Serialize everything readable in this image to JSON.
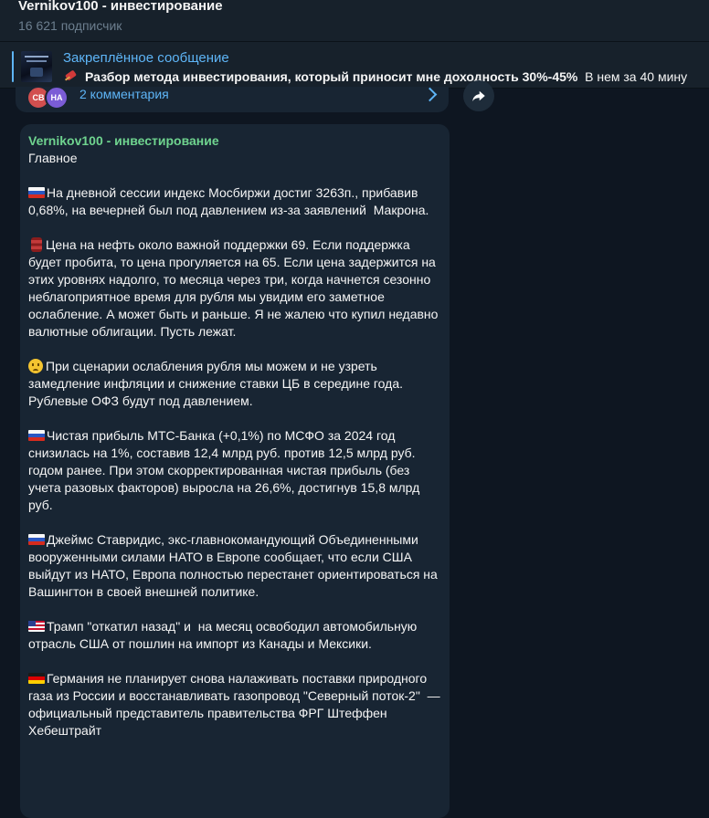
{
  "header": {
    "title": "Vernikov100 - инвестирование",
    "subscribers": "16 621 подписчик"
  },
  "pinned": {
    "label": "Закреплённое сообщение",
    "text_bold": "Разбор метода инвестирования, который приносит мне доходность 30%-45%",
    "text_rest": "В нем за 40 мину"
  },
  "prev_message": {
    "avatar1": "СВ",
    "avatar2": "НА",
    "comments": "2 комментария"
  },
  "message": {
    "sender": "Vernikov100 - инвестирование",
    "title": "Главное",
    "paragraphs": [
      "На дневной сессии индекс Мосбиржи достиг 3263п., прибавив 0,68%, на вечерней был под давлением из-за заявлений  Макрона.",
      "Цена на нефть около важной поддержки 69. Если поддержка будет пробита, то цена прогуляется на 65. Если цена задержится на этих уровнях надолго, то месяца через три, когда начнется сезонно неблагоприятное время для рубля мы увидим его заметное ослабление. А может быть и раньше. Я не жалею что купил недавно валютные облигации. Пусть лежат.",
      "При сценарии ослабления рубля мы можем и не узреть замедление инфляции и снижение ставки ЦБ в середине года. Рублевые ОФЗ будут под давлением.",
      "Чистая прибыль МТС-Банка (+0,1%) по МСФО за 2024 год снизилась на 1%, составив 12,4 млрд руб. против 12,5 млрд руб. годом ранее. При этом скорректированная чистая прибыль (без учета разовых факторов) выросла на 26,6%, достигнув 15,8 млрд руб.",
      "Джеймс Ставридис, экс-главнокомандующий Объединенными вооруженными силами НАТО в Европе сообщает, что если США выйдут из НАТО, Европа полностью перестанет ориентироваться на Вашингтон в своей внешней политике.",
      "Трамп \"откатил назад\" и  на месяц освободил автомобильную отрасль США от пошлин на импорт из Канады и Мексики.",
      "Германия не планирует снова налаживать поставки природного газа из России и восстанавливать газопровод \"Северный поток-2\"  — официальный представитель правительства ФРГ Штеффен Хебештрайт"
    ]
  }
}
